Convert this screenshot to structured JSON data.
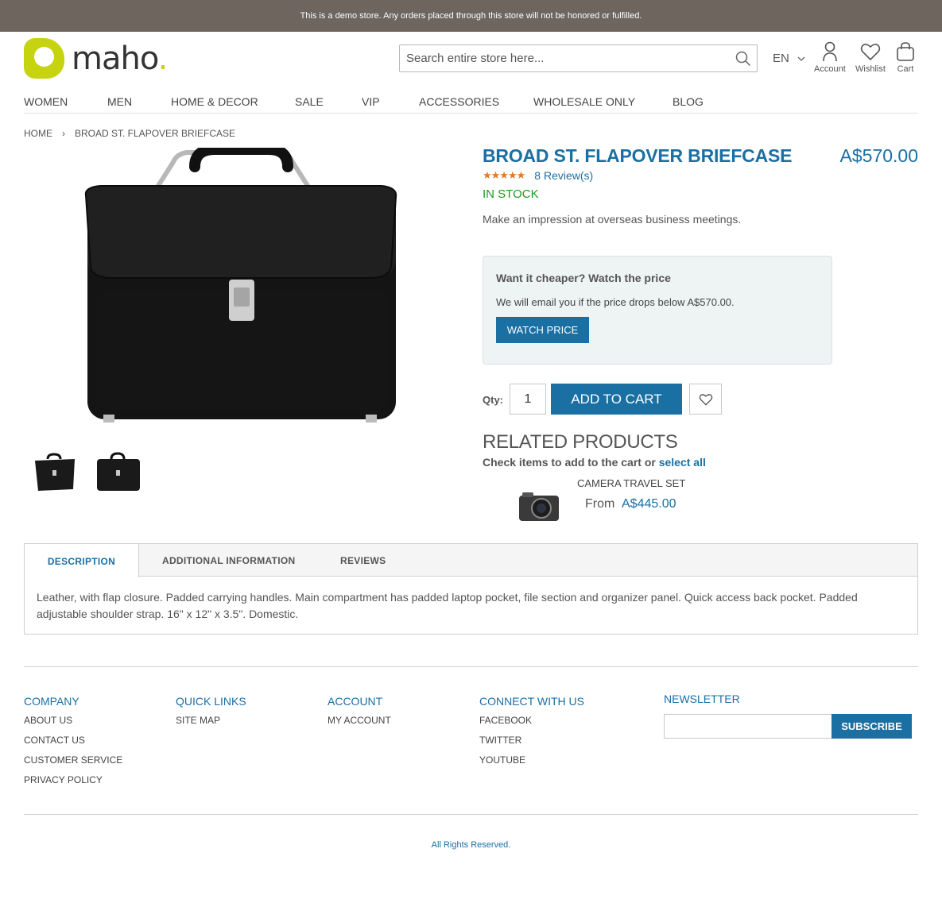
{
  "demo_notice": "This is a demo store. Any orders placed through this store will not be honored or fulfilled.",
  "logo": {
    "text": "maho",
    "dot": ".",
    "brand_color": "#c6d30f"
  },
  "search": {
    "placeholder": "Search entire store here...",
    "value": ""
  },
  "language": {
    "selected": "EN"
  },
  "header_links": {
    "account": "Account",
    "wishlist": "Wishlist",
    "cart": "Cart"
  },
  "nav": [
    "WOMEN",
    "MEN",
    "HOME & DECOR",
    "SALE",
    "VIP",
    "ACCESSORIES",
    "WHOLESALE ONLY",
    "BLOG"
  ],
  "breadcrumb": {
    "home": "HOME",
    "separator": "›",
    "current": "BROAD ST. FLAPOVER BRIEFCASE"
  },
  "product": {
    "name": "BROAD ST. FLAPOVER BRIEFCASE",
    "price": "A$570.00",
    "rating_fraction": 0.9,
    "reviews": "8 Review(s)",
    "stock": "IN STOCK",
    "short_description": "Make an impression at overseas business meetings.",
    "qty": "1",
    "qty_label": "Qty:",
    "add_to_cart": "ADD TO CART"
  },
  "watch_price": {
    "title": "Want it cheaper? Watch the price",
    "text": "We will email you if the price drops below A$570.00.",
    "button": "WATCH PRICE"
  },
  "related": {
    "title": "RELATED PRODUCTS",
    "subtitle": "Check items to add to the cart or",
    "select_all": "select all",
    "item": {
      "name": "CAMERA TRAVEL SET",
      "from": "From",
      "price": "A$445.00"
    }
  },
  "tabs": {
    "description": "DESCRIPTION",
    "additional": "ADDITIONAL INFORMATION",
    "reviews": "REVIEWS",
    "content": "Leather, with flap closure. Padded carrying handles. Main compartment has padded laptop pocket, file section and organizer panel. Quick access back pocket. Padded adjustable shoulder strap. 16\" x 12\" x 3.5\". Domestic."
  },
  "footer": {
    "company": {
      "title": "COMPANY",
      "links": [
        "ABOUT US",
        "CONTACT US",
        "CUSTOMER SERVICE",
        "PRIVACY POLICY"
      ]
    },
    "quick_links": {
      "title": "QUICK LINKS",
      "links": [
        "SITE MAP"
      ]
    },
    "account": {
      "title": "ACCOUNT",
      "links": [
        "MY ACCOUNT"
      ]
    },
    "connect": {
      "title": "CONNECT WITH US",
      "links": [
        "FACEBOOK",
        "TWITTER",
        "YOUTUBE"
      ]
    },
    "newsletter": {
      "title": "NEWSLETTER",
      "button": "SUBSCRIBE"
    },
    "copyright": "All Rights Reserved."
  },
  "colors": {
    "primary": "#1a6fa3",
    "stock": "#1e9a1e",
    "star": "#e07b2a",
    "demo_bar": "#6d655e"
  }
}
